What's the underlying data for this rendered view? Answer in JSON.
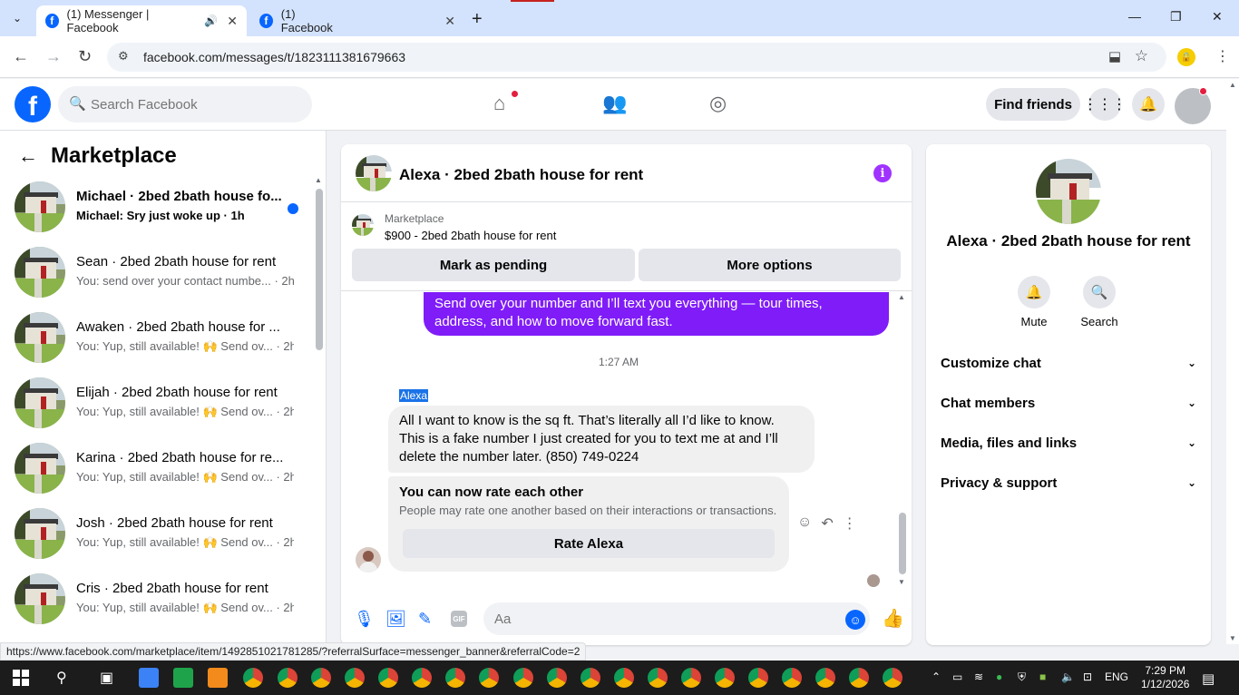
{
  "browser": {
    "tabs": [
      {
        "title": "(1) Messenger | Facebook",
        "active": true
      },
      {
        "title": "(1) Facebook",
        "active": false
      }
    ],
    "url": "facebook.com/messages/t/1823111381679663"
  },
  "fb": {
    "search_placeholder": "Search Facebook",
    "find_friends": "Find friends"
  },
  "left": {
    "title": "Marketplace",
    "conversations": [
      {
        "name": "Michael · 2bed 2bath house fo...",
        "preview": "Michael: Sry just woke up · 1h",
        "unread": true
      },
      {
        "name": "Sean · 2bed 2bath house for rent",
        "preview": "You: send over your contact numbe... · 2h",
        "unread": false
      },
      {
        "name": "Awaken · 2bed 2bath house for ...",
        "preview": "You: Yup, still available! 🙌 Send ov... · 2h",
        "unread": false
      },
      {
        "name": "Elijah · 2bed 2bath house for rent",
        "preview": "You: Yup, still available! 🙌 Send ov... · 2h",
        "unread": false
      },
      {
        "name": "Karina · 2bed 2bath house for re...",
        "preview": "You: Yup, still available! 🙌 Send ov... · 2h",
        "unread": false
      },
      {
        "name": "Josh · 2bed 2bath house for rent",
        "preview": "You: Yup, still available! 🙌 Send ov... · 2h",
        "unread": false
      },
      {
        "name": "Cris · 2bed 2bath house for rent",
        "preview": "You: Yup, still available! 🙌 Send ov... · 2h",
        "unread": false
      }
    ]
  },
  "chat": {
    "title": "Alexa · 2bed 2bath house for rent",
    "marketplace_label": "Marketplace",
    "listing": "$900 - 2bed 2bath house for rent",
    "mark_pending": "Mark as pending",
    "more_options": "More options",
    "outgoing": "Send over your number and I’ll text you everything — tour times, address, and how to move forward fast.",
    "timestamp": "1:27 AM",
    "sender": "Alexa",
    "incoming": "All I want to know is the sq ft. That’s literally all I’d like to know. This is a fake number I just created for you to text me at and I’ll delete the number later. (850) 749-0224",
    "rate_title": "You can now rate each other",
    "rate_sub": "People may rate one another based on their interactions or transactions.",
    "rate_button": "Rate Alexa",
    "composer_placeholder": "Aa"
  },
  "right": {
    "name": "Alexa · 2bed 2bath house for rent",
    "mute": "Mute",
    "search": "Search",
    "rows": [
      "Customize chat",
      "Chat members",
      "Media, files and links",
      "Privacy & support"
    ]
  },
  "status_url": "https://www.facebook.com/marketplace/item/1492851021781285/?referralSurface=messenger_banner&referralCode=2",
  "taskbar": {
    "time": "7:29 PM",
    "date": "1/12/2026",
    "lang": "ENG"
  },
  "colors": {
    "fb_blue": "#0866ff",
    "messenger_purple": "#7f1cf8",
    "unread_dot": "#0866ff"
  }
}
